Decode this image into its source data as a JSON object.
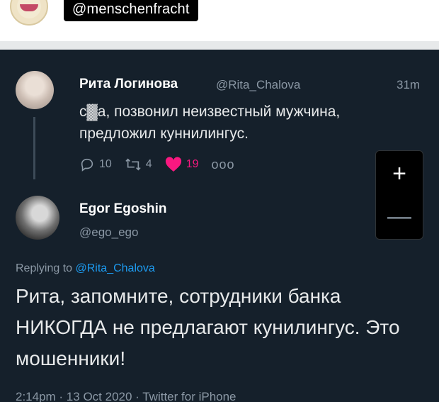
{
  "header": {
    "handle": "@menschenfracht"
  },
  "parent_tweet": {
    "name": "Рита Логинова",
    "username": "@Rita_Chalova",
    "time": "31m",
    "text": "с▓а, позвонил неизвестный мужчина, предложил куннилингус.",
    "replies": "10",
    "retweets": "4",
    "likes": "19",
    "more": "ooo"
  },
  "zoom": {
    "plus": "+",
    "minus": "—"
  },
  "reply_tweet": {
    "name": "Egor Egoshin",
    "username": "@ego_ego",
    "replying_prefix": "Replying to",
    "replying_to": "@Rita_Chalova",
    "text": "Рита, запомните, сотрудники банка НИКОГДА не предлагают кунилингус. Это мошенники!",
    "footer": "2:14pm · 13 Oct 2020 · Twitter for iPhone"
  },
  "colors": {
    "background_dark": "#15202b",
    "text": "#e7e9ea",
    "muted": "#8b98a5",
    "link": "#1d9bf0",
    "like": "#f91880"
  },
  "icons": {
    "reply": "reply-icon",
    "retweet": "retweet-icon",
    "like": "heart-icon",
    "more": "more-icon"
  }
}
